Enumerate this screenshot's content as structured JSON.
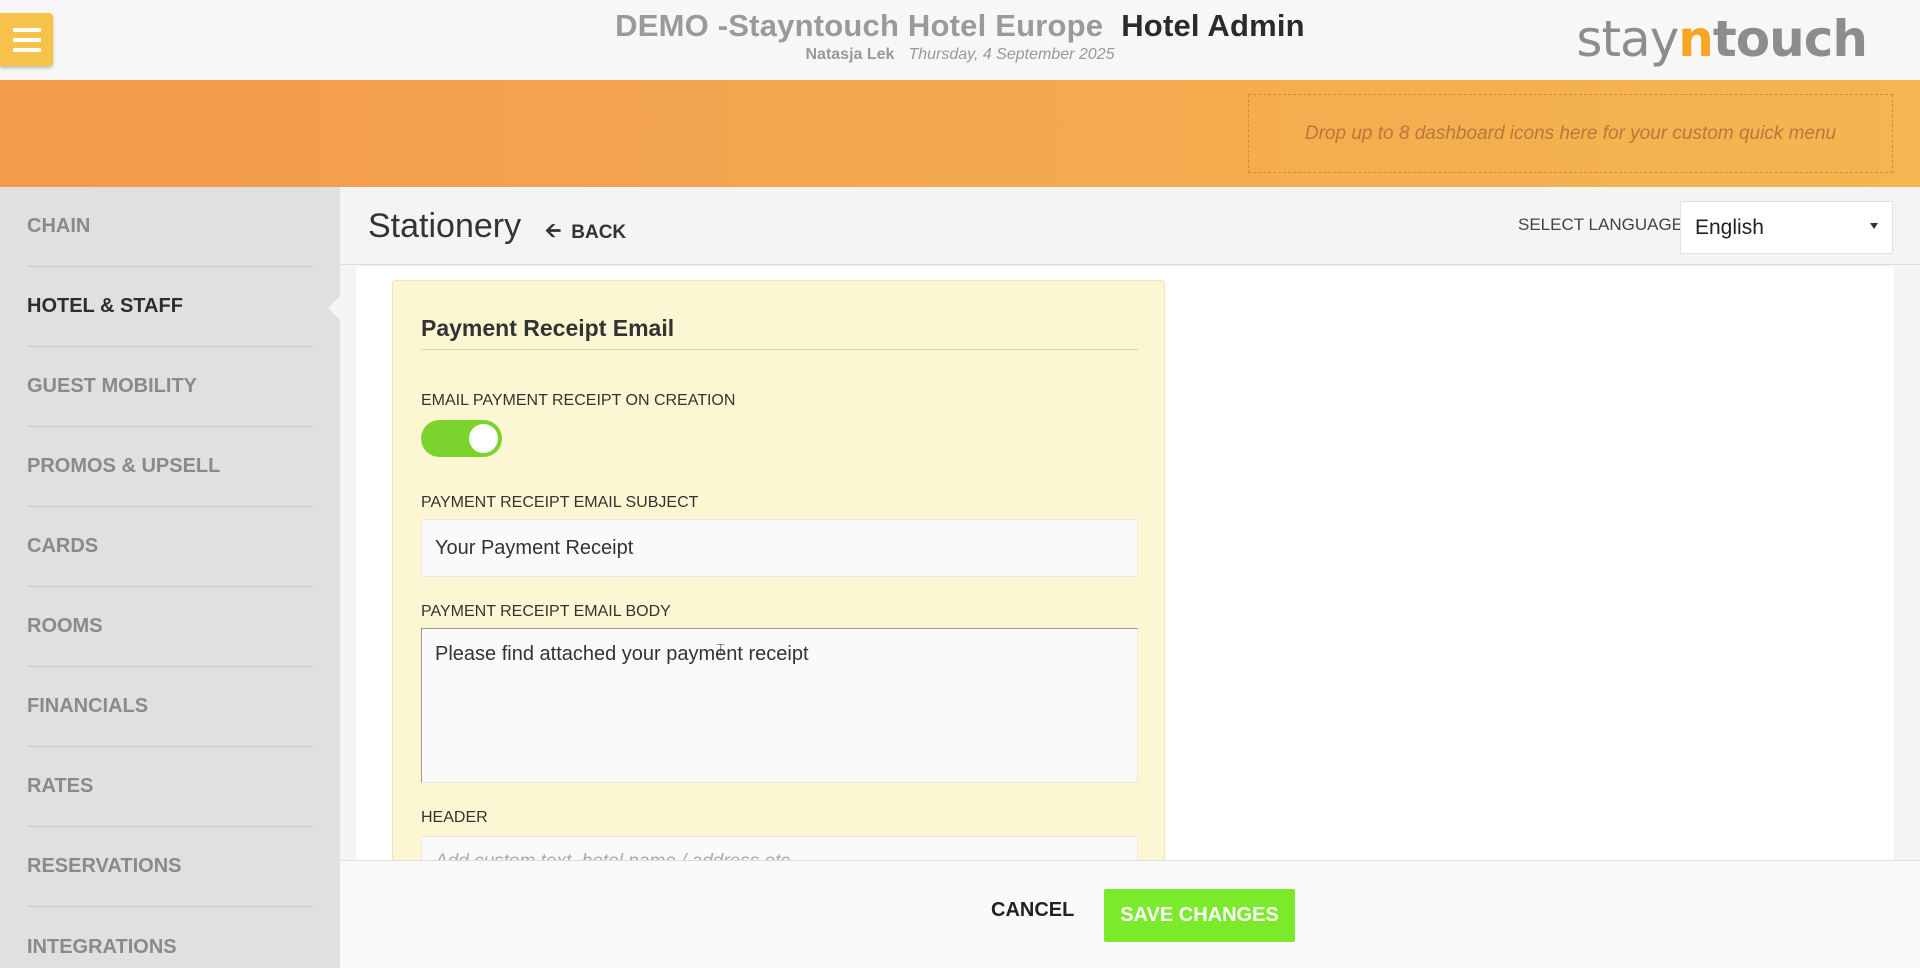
{
  "header": {
    "hotel_name": "DEMO -Stayntouch Hotel Europe",
    "app_title": "Hotel Admin",
    "user_name": "Natasja Lek",
    "date": "Thursday, 4 September 2025",
    "logo_prefix": "stay",
    "logo_n": "n",
    "logo_suffix": "touch",
    "menu_icon": "hamburger-icon"
  },
  "quick_menu": {
    "placeholder": "Drop up to 8 dashboard icons here for your custom quick menu"
  },
  "sidebar": {
    "items": [
      {
        "label": "CHAIN",
        "active": false
      },
      {
        "label": "HOTEL & STAFF",
        "active": true
      },
      {
        "label": "GUEST MOBILITY",
        "active": false
      },
      {
        "label": "PROMOS & UPSELL",
        "active": false
      },
      {
        "label": "CARDS",
        "active": false
      },
      {
        "label": "ROOMS",
        "active": false
      },
      {
        "label": "FINANCIALS",
        "active": false
      },
      {
        "label": "RATES",
        "active": false
      },
      {
        "label": "RESERVATIONS",
        "active": false
      },
      {
        "label": "INTEGRATIONS",
        "active": false
      }
    ]
  },
  "page": {
    "title": "Stationery",
    "back_label": "BACK",
    "back_icon": "arrow-left-icon",
    "language_label": "SELECT LANGUAGE",
    "language_value": "English"
  },
  "form": {
    "section_title": "Payment Receipt Email",
    "toggle_label": "EMAIL PAYMENT RECEIPT ON CREATION",
    "toggle_on": true,
    "subject_label": "PAYMENT RECEIPT EMAIL SUBJECT",
    "subject_value": "Your Payment Receipt",
    "body_label": "PAYMENT RECEIPT EMAIL BODY",
    "body_value": "Please find attached your payment receipt",
    "header_label": "HEADER",
    "header_placeholder": "Add custom text, hotel name / address etc."
  },
  "footer": {
    "cancel_label": "CANCEL",
    "save_label": "SAVE CHANGES"
  },
  "colors": {
    "accent_orange": "#f4a94e",
    "toggle_green": "#7bd32e",
    "save_green": "#7bea2a",
    "card_bg": "#fdf6d2"
  }
}
